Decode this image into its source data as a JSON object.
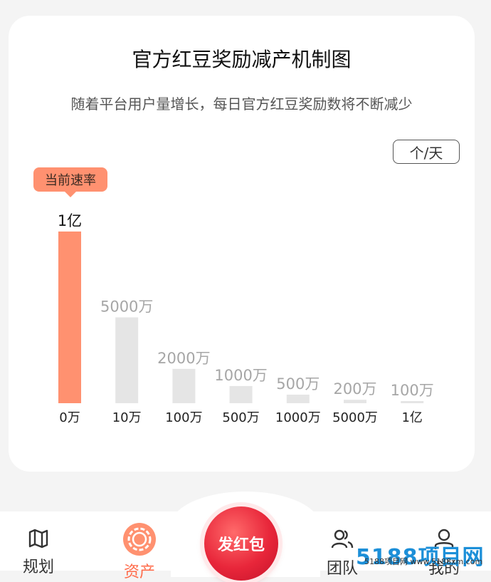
{
  "card": {
    "title": "官方红豆奖励减产机制图",
    "subtitle": "随着平台用户量增长，每日官方红豆奖励数将不断减少",
    "unit_label": "个/天",
    "rate_badge": "当前速率"
  },
  "chart_data": {
    "type": "bar",
    "categories": [
      "0万",
      "10万",
      "100万",
      "500万",
      "1000万",
      "5000万",
      "1亿"
    ],
    "values": [
      100000000,
      50000000,
      20000000,
      10000000,
      5000000,
      2000000,
      1000000
    ],
    "value_labels": [
      "1亿",
      "5000万",
      "2000万",
      "1000万",
      "500万",
      "200万",
      "100万"
    ],
    "ylim": [
      0,
      100000000
    ],
    "highlight_index": 0,
    "colors": {
      "highlight": "#ff9170",
      "normal": "#e5e5e5",
      "label_highlight": "#111111",
      "label_normal": "#a6a6a6",
      "category": "#222222"
    },
    "grid": false,
    "legend": "none"
  },
  "tabbar": {
    "items": [
      {
        "label": "规划",
        "icon": "map-icon"
      },
      {
        "label": "资产",
        "icon": "asset-coin-icon"
      },
      {
        "label": "发红包",
        "icon": "red-packet-icon"
      },
      {
        "label": "团队",
        "icon": "team-icon"
      },
      {
        "label": "我的",
        "icon": "user-icon"
      }
    ]
  },
  "watermark": {
    "text": "5188项目网",
    "subtext": "5188项目网 www.5188xm.com"
  }
}
